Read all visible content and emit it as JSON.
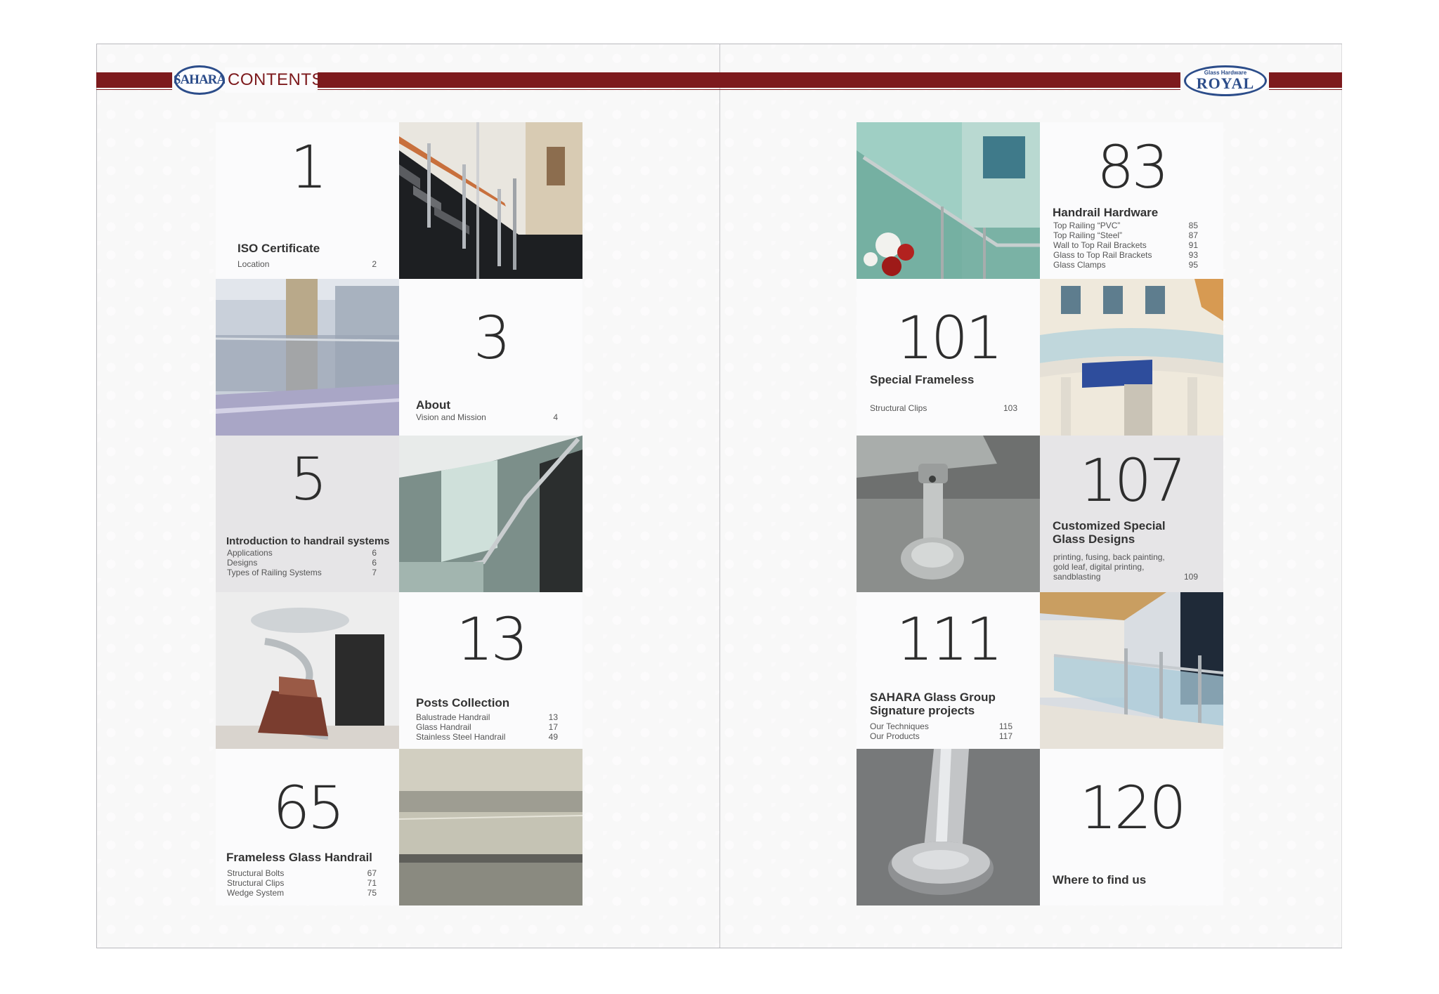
{
  "header": {
    "title": "CONTENTS",
    "left_logo": "SAHARA",
    "right_logo_top": "Glass Hardware",
    "right_logo_main": "ROYAL"
  },
  "sections": [
    {
      "number": "1",
      "title": "ISO Certificate",
      "items": [
        {
          "label": "Location",
          "page": "2"
        }
      ]
    },
    {
      "number": "3",
      "title": "About",
      "items": [
        {
          "label": "Vision and Mission",
          "page": "4"
        }
      ]
    },
    {
      "number": "5",
      "title": "Introduction to handrail systems",
      "items": [
        {
          "label": "Applications",
          "page": "6"
        },
        {
          "label": "Designs",
          "page": "6"
        },
        {
          "label": "Types of Railing Systems",
          "page": "7"
        }
      ]
    },
    {
      "number": "13",
      "title": "Posts Collection",
      "items": [
        {
          "label": "Balustrade Handrail",
          "page": "13"
        },
        {
          "label": "Glass Handrail",
          "page": "17"
        },
        {
          "label": "Stainless Steel Handrail",
          "page": "49"
        }
      ]
    },
    {
      "number": "65",
      "title": "Frameless Glass Handrail",
      "items": [
        {
          "label": "Structural Bolts",
          "page": "67"
        },
        {
          "label": "Structural Clips",
          "page": "71"
        },
        {
          "label": "Wedge System",
          "page": "75"
        }
      ]
    },
    {
      "number": "83",
      "title": "Handrail Hardware",
      "items": [
        {
          "label": "Top Railing “PVC”",
          "page": "85"
        },
        {
          "label": "Top Railing “Steel”",
          "page": "87"
        },
        {
          "label": "Wall to Top Rail Brackets",
          "page": "91"
        },
        {
          "label": "Glass to Top Rail Brackets",
          "page": "93"
        },
        {
          "label": "Glass Clamps",
          "page": "95"
        }
      ]
    },
    {
      "number": "101",
      "title": "Special Frameless",
      "items": [
        {
          "label": "Structural Clips",
          "page": "103"
        }
      ]
    },
    {
      "number": "107",
      "title_line1": "Customized Special",
      "title_line2": "Glass Designs",
      "desc_line1": "printing, fusing, back painting,",
      "desc_line2": "gold leaf, digital printing,",
      "desc_line3": "sandblasting",
      "page": "109"
    },
    {
      "number": "111",
      "title_line1": "SAHARA Glass Group",
      "title_line2": "Signature projects",
      "items": [
        {
          "label": "Our Techniques",
          "page": "115"
        },
        {
          "label": "Our Products",
          "page": "117"
        }
      ]
    },
    {
      "number": "120",
      "title": "Where to find us"
    }
  ],
  "colors": {
    "banner": "#7d1a1d",
    "logo_blue": "#2c4d8a"
  }
}
